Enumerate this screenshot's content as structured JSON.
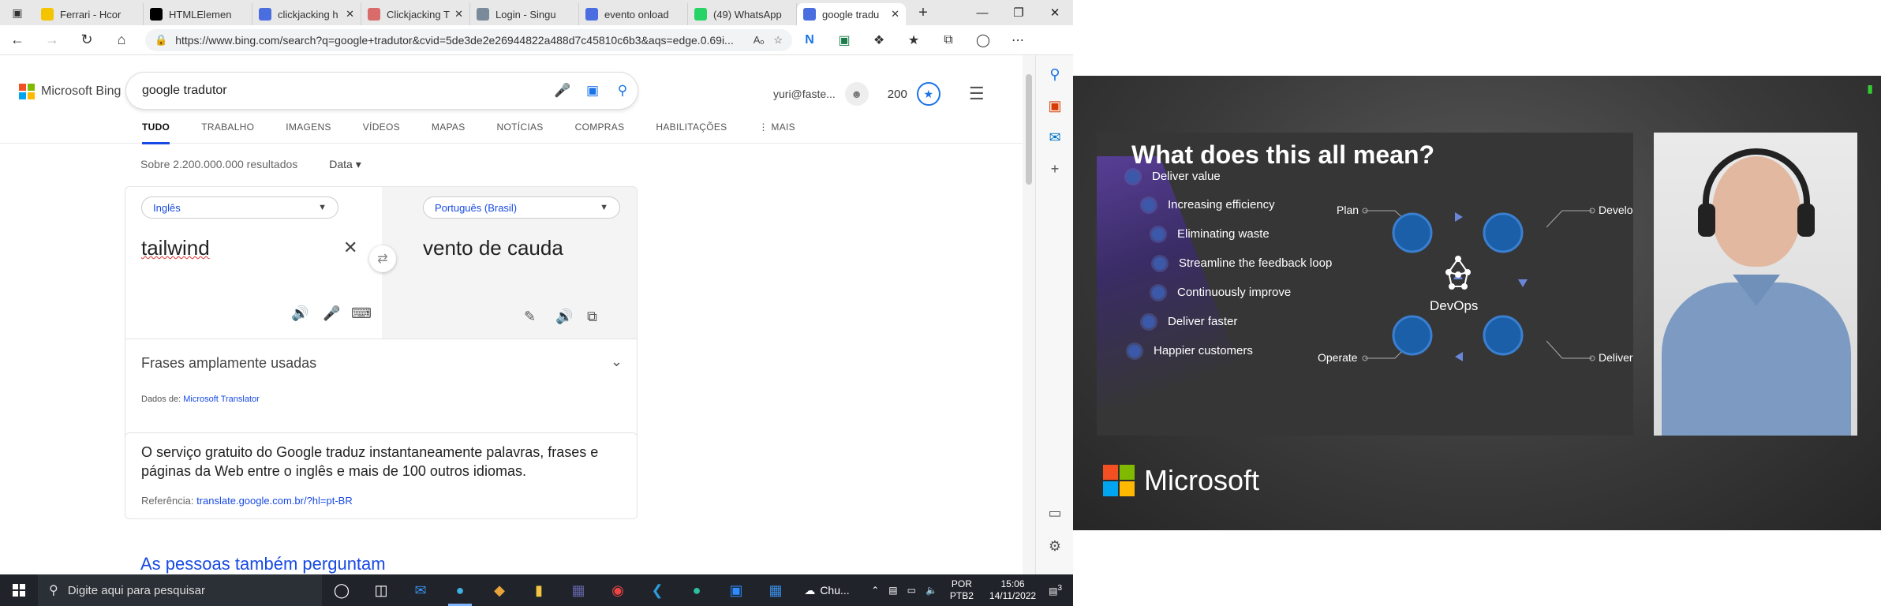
{
  "browser": {
    "tabs": [
      {
        "title": "Ferrari - Hcor",
        "favicon": "ferrari-icon",
        "color": "#f5c400"
      },
      {
        "title": "HTMLElemen",
        "favicon": "mdn-icon",
        "color": "#000000"
      },
      {
        "title": "clickjacking h",
        "favicon": "search-icon",
        "color": "#4a6ee0"
      },
      {
        "title": "Clickjacking T",
        "favicon": "page-icon",
        "color": "#d96b6b"
      },
      {
        "title": "Login - Singu",
        "favicon": "page-icon",
        "color": "#7a8a9a"
      },
      {
        "title": "evento onload",
        "favicon": "search-icon",
        "color": "#4a6ee0"
      },
      {
        "title": "(49) WhatsApp",
        "favicon": "whatsapp-icon",
        "color": "#25d366"
      },
      {
        "title": "google tradu",
        "favicon": "search-icon",
        "color": "#4a6ee0"
      }
    ],
    "url": "https://www.bing.com/search?q=google+tradutor&cvid=5de3de2e26944822a488d7c45810c6b3&aqs=edge.0.69i...",
    "read_aloud": "Aₒ"
  },
  "bing": {
    "brand": "Microsoft Bing",
    "query": "google tradutor",
    "account": "yuri@faste...",
    "points": "200",
    "scopes": [
      "TUDO",
      "TRABALHO",
      "IMAGENS",
      "VÍDEOS",
      "MAPAS",
      "NOTÍCIAS",
      "COMPRAS",
      "HABILITAÇÕES",
      "⋮ MAIS"
    ],
    "result_count": "Sobre 2.200.000.000 resultados",
    "date_filter": "Data ▾",
    "translator": {
      "source_lang": "Inglês",
      "target_lang": "Português (Brasil)",
      "source_text": "tailwind",
      "target_text": "vento de cauda",
      "phrases": "Frases amplamente usadas",
      "credit_label": "Dados de:",
      "credit_link": "Microsoft Translator"
    },
    "description": "O serviço gratuito do Google traduz instantaneamente palavras, frases e páginas da Web entre o inglês e mais de 100 outros idiomas.",
    "ref_label": "Referência:",
    "ref_link": "translate.google.com.br/?hl=pt-BR",
    "paa": "As pessoas também perguntam"
  },
  "taskbar": {
    "search_placeholder": "Digite aqui para pesquisar",
    "weather": "Chu...",
    "lang_top": "POR",
    "lang_bottom": "PTB2",
    "time": "15:06",
    "date": "14/11/2022",
    "notifications": "3"
  },
  "video": {
    "slide_title": "What does this all mean?",
    "bullets": [
      "Deliver value",
      "Increasing efficiency",
      "Eliminating waste",
      "Streamline the feedback loop",
      "Continuously improve",
      "Deliver faster",
      "Happier customers"
    ],
    "devops": {
      "center": "DevOps",
      "plan": "Plan",
      "develop": "Develop",
      "operate": "Operate",
      "deliver": "Deliver"
    },
    "brand": "Microsoft"
  },
  "colors": {
    "ms_red": "#f25022",
    "ms_green": "#7fba00",
    "ms_blue": "#00a4ef",
    "ms_yellow": "#ffb900",
    "bing_blue": "#174ae4"
  }
}
